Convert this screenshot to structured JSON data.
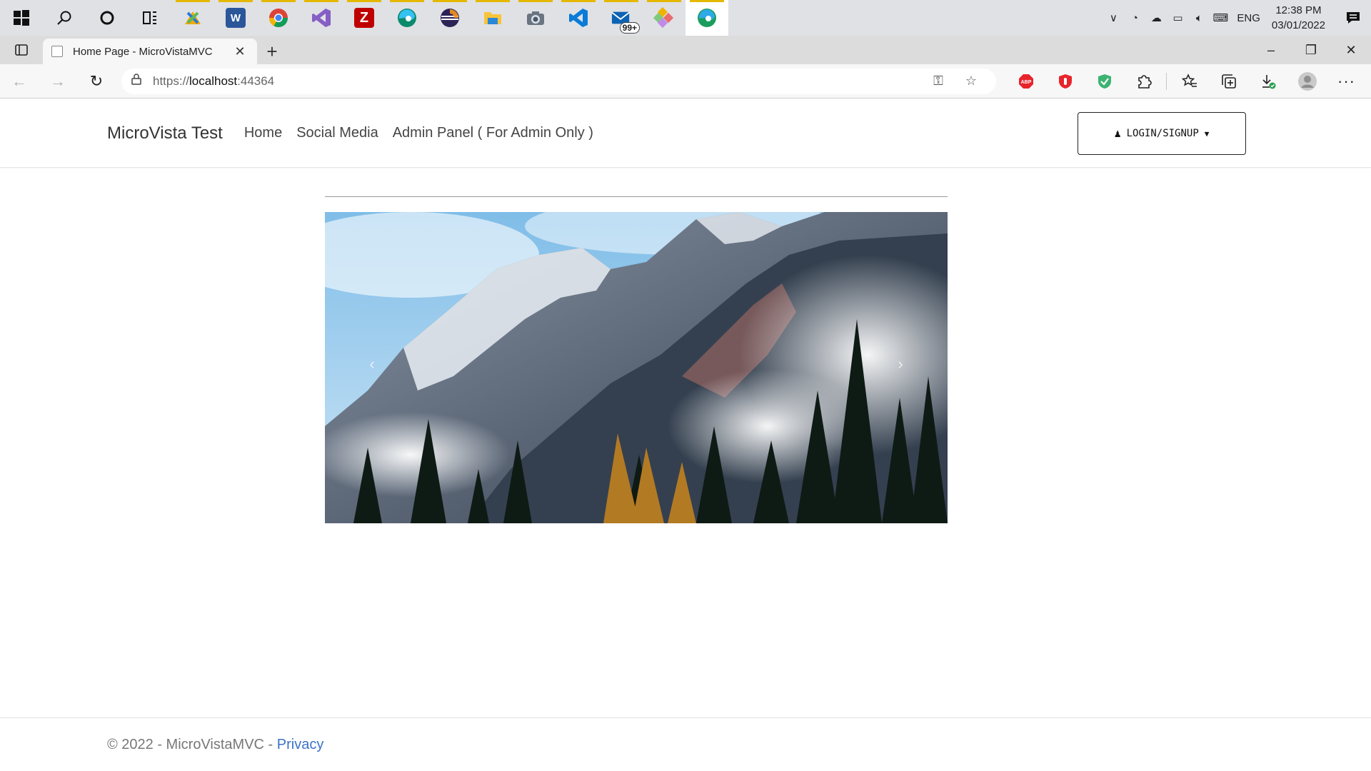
{
  "taskbar": {
    "apps": [
      {
        "icon": "windows-start-icon"
      },
      {
        "icon": "search-icon"
      },
      {
        "icon": "cortana-icon"
      },
      {
        "icon": "task-view-icon"
      },
      {
        "icon": "feedback-hub-icon",
        "running": true
      },
      {
        "icon": "word-icon",
        "letter": "W",
        "color": "#2b579a",
        "running": true
      },
      {
        "icon": "chrome-icon",
        "running": true
      },
      {
        "icon": "visual-studio-icon",
        "running": true
      },
      {
        "icon": "filezilla-icon",
        "letter": "Z",
        "color": "#bf0000",
        "running": true
      },
      {
        "icon": "edge-dev-icon",
        "running": true
      },
      {
        "icon": "eclipse-icon",
        "running": true
      },
      {
        "icon": "file-explorer-icon",
        "running": true
      },
      {
        "icon": "camera-icon",
        "running": true
      },
      {
        "icon": "vscode-icon",
        "running": true
      },
      {
        "icon": "mail-icon",
        "badge": "99+",
        "running": true
      },
      {
        "icon": "gitkraken-icon",
        "running": true
      },
      {
        "icon": "edge-icon",
        "running": true,
        "active": true
      }
    ],
    "tray": {
      "language": "ENG",
      "time": "12:38 PM",
      "date": "03/01/2022"
    }
  },
  "browser": {
    "tab_title": "Home Page - MicroVistaMVC",
    "url_scheme": "https://",
    "url_host": "localhost",
    "url_port": ":44364"
  },
  "site": {
    "brand": "MicroVista Test",
    "nav": [
      "Home",
      "Social Media",
      "Admin Panel ( For Admin Only )"
    ],
    "login_label": "LOGIN/SIGNUP",
    "carousel": {
      "prev_glyph": "‹",
      "next_glyph": "›"
    },
    "footer_text": "© 2022 - MicroVistaMVC - ",
    "footer_link": "Privacy"
  },
  "colors": {
    "link": "#3b73c9",
    "taskbar_bg": "#dfe1e5",
    "running_indicator": "#e5b800"
  }
}
